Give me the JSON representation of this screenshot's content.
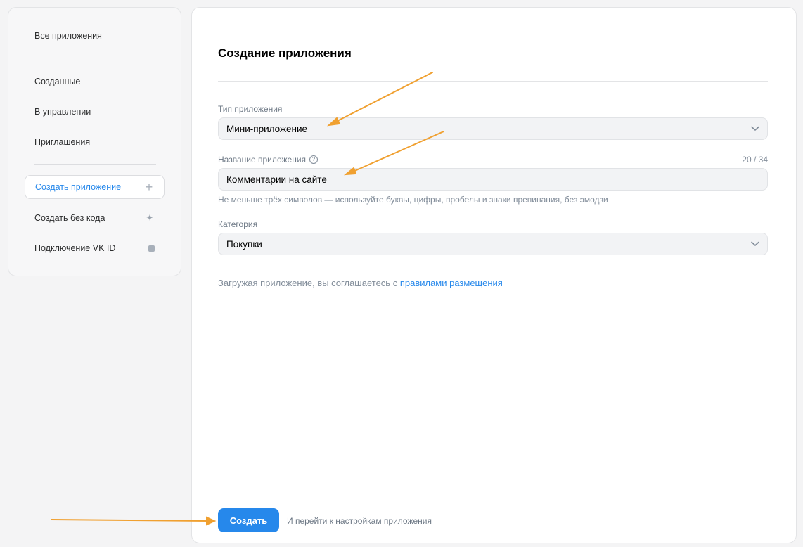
{
  "sidebar": {
    "all_apps": "Все приложения",
    "created": "Созданные",
    "managed": "В управлении",
    "invitations": "Приглашения",
    "create_app": "Создать приложение",
    "create_no_code": "Создать без кода",
    "vk_id": "Подключение VK ID"
  },
  "form": {
    "title": "Создание приложения",
    "type_label": "Тип приложения",
    "type_value": "Мини-приложение",
    "name_label": "Название приложения",
    "name_value": "Комментарии на сайте",
    "name_counter": "20 / 34",
    "name_hint": "Не меньше трёх символов — используйте буквы, цифры, пробелы и знаки препинания, без эмодзи",
    "category_label": "Категория",
    "category_value": "Покупки",
    "terms_text": "Загружая приложение, вы соглашаетесь с ",
    "terms_link": "правилами размещения"
  },
  "footer": {
    "create_button": "Создать",
    "note": "И перейти к настройкам приложения"
  },
  "colors": {
    "accent": "#2688eb",
    "annotation_arrow": "#f0a030"
  }
}
